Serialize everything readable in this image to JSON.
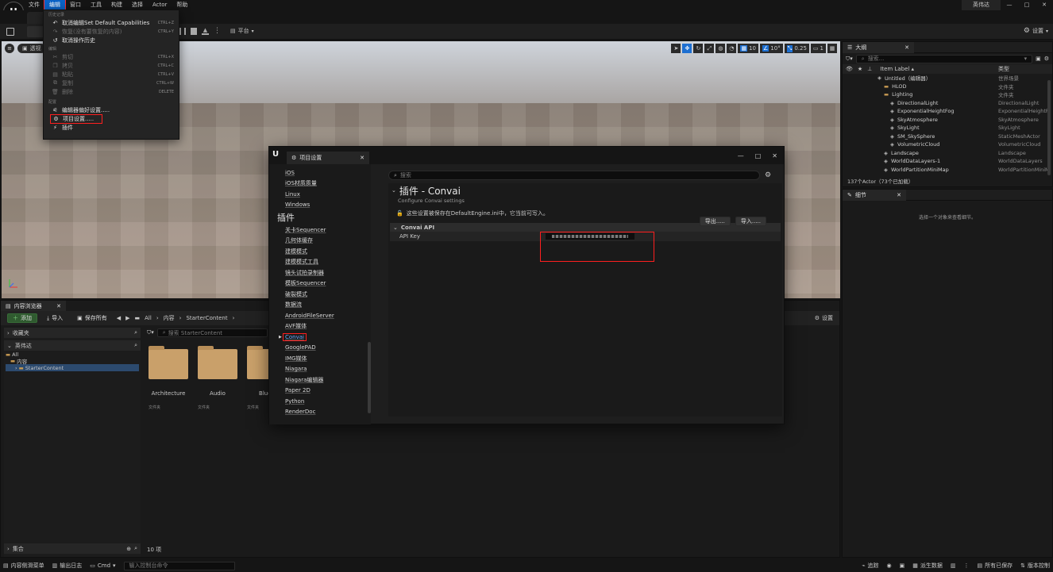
{
  "menubar": {
    "items": [
      "文件",
      "编辑",
      "窗口",
      "工具",
      "构建",
      "选择",
      "Actor",
      "帮助"
    ],
    "user_name": "英伟达",
    "window_controls": [
      "—",
      "□",
      "✕"
    ]
  },
  "toolbar": {
    "platform_label": "平台",
    "settings_label": "设置"
  },
  "viewport": {
    "perspective_label": "透视",
    "grid_snap": "10",
    "rotate_snap": "10°",
    "scale_snap": "0.25",
    "camera_speed": "1"
  },
  "edit_menu": {
    "section_history": "历史记录",
    "undo_label": "取消编辑Set Default Capabilities",
    "undo_shortcut": "CTRL+Z",
    "redo_label": "恢复(没有要恢复的内容)",
    "redo_shortcut": "CTRL+Y",
    "undo_history_label": "取消操作历史",
    "section_edit": "编辑",
    "cut_label": "剪切",
    "cut_shortcut": "CTRL+X",
    "copy_label": "拷贝",
    "copy_shortcut": "CTRL+C",
    "paste_label": "粘贴",
    "paste_shortcut": "CTRL+V",
    "duplicate_label": "复制",
    "duplicate_shortcut": "CTRL+W",
    "delete_label": "删除",
    "delete_shortcut": "DELETE",
    "section_config": "配置",
    "editor_prefs_label": "编辑器偏好设置.....",
    "project_settings_label": "项目设置.....",
    "plugins_label": "插件"
  },
  "project_settings": {
    "tab_title": "项目设置",
    "search_placeholder": "搜索",
    "platform_items": [
      "iOS",
      "iOS材质质量",
      "Linux",
      "Windows"
    ],
    "plugins_header": "插件",
    "plugin_items": [
      "关卡Sequencer",
      "几何体缓存",
      "建模模式",
      "建模模式工具",
      "镜头试拍录制器",
      "模板Sequencer",
      "破裂模式",
      "数据流",
      "AndroidFileServer",
      "AVF媒体",
      "Convai",
      "GooglePAD",
      "IMG媒体",
      "Niagara",
      "Niagara编辑器",
      "Paper 2D",
      "Python",
      "RenderDoc"
    ],
    "page_title": "插件 - Convai",
    "page_subtitle": "Configure Convai settings",
    "export_button": "导出.....",
    "import_button": "导入.....",
    "notice": "这些设置被保存在DefaultEngine.ini中，它当前可写入。",
    "category_label": "Convai API",
    "api_key_label": "API Key"
  },
  "outliner": {
    "tab_title": "大纲",
    "search_placeholder": "搜索...",
    "col_label": "Item Label ▴",
    "col_type": "类型",
    "rows": [
      {
        "label": "Untitled（编辑器）",
        "type": "世界场景",
        "indent": 0
      },
      {
        "label": "HLOD",
        "type": "文件夹",
        "indent": 1
      },
      {
        "label": "Lighting",
        "type": "文件夹",
        "indent": 1
      },
      {
        "label": "DirectionalLight",
        "type": "DirectionalLight",
        "indent": 2
      },
      {
        "label": "ExponentialHeightFog",
        "type": "ExponentialHeightF",
        "indent": 2
      },
      {
        "label": "SkyAtmosphere",
        "type": "SkyAtmosphere",
        "indent": 2
      },
      {
        "label": "SkyLight",
        "type": "SkyLight",
        "indent": 2
      },
      {
        "label": "SM_SkySphere",
        "type": "StaticMeshActor",
        "indent": 2
      },
      {
        "label": "VolumetricCloud",
        "type": "VolumetricCloud",
        "indent": 2
      },
      {
        "label": "Landscape",
        "type": "Landscape",
        "indent": 1
      },
      {
        "label": "WorldDataLayers-1",
        "type": "WorldDataLayers",
        "indent": 1
      },
      {
        "label": "WorldPartitionMiniMap",
        "type": "WorldPartitionMiniM",
        "indent": 1
      }
    ],
    "footer": "137个Actor（73个已加载）"
  },
  "details": {
    "tab_title": "细节",
    "empty_text": "选择一个对象来查看细节。"
  },
  "content_browser": {
    "tab_title": "内容浏览器",
    "add_button": "添加",
    "import_button": "导入",
    "save_all_button": "保存所有",
    "breadcrumb": [
      "All",
      "内容",
      "StarterContent"
    ],
    "settings_label": "设置",
    "favorites_label": "收藏夹",
    "project_label": "英伟达",
    "tree": [
      "All",
      "内容",
      "StarterContent"
    ],
    "search_placeholder": "搜索 StarterContent",
    "folders": [
      {
        "name": "Architecture",
        "type": "文件夹"
      },
      {
        "name": "Audio",
        "type": "文件夹"
      },
      {
        "name": "Bluep",
        "type": "文件夹"
      }
    ],
    "collections_label": "集合",
    "item_count": "10 项"
  },
  "statusbar": {
    "drawer_label": "内容侧滑菜单",
    "output_log_label": "输出日志",
    "cmd_label": "Cmd",
    "console_placeholder": "输入控制台命令",
    "trace_label": "追踪",
    "derived_data_label": "派生数据",
    "saved_label": "所有已保存",
    "source_control_label": "版本控制"
  }
}
